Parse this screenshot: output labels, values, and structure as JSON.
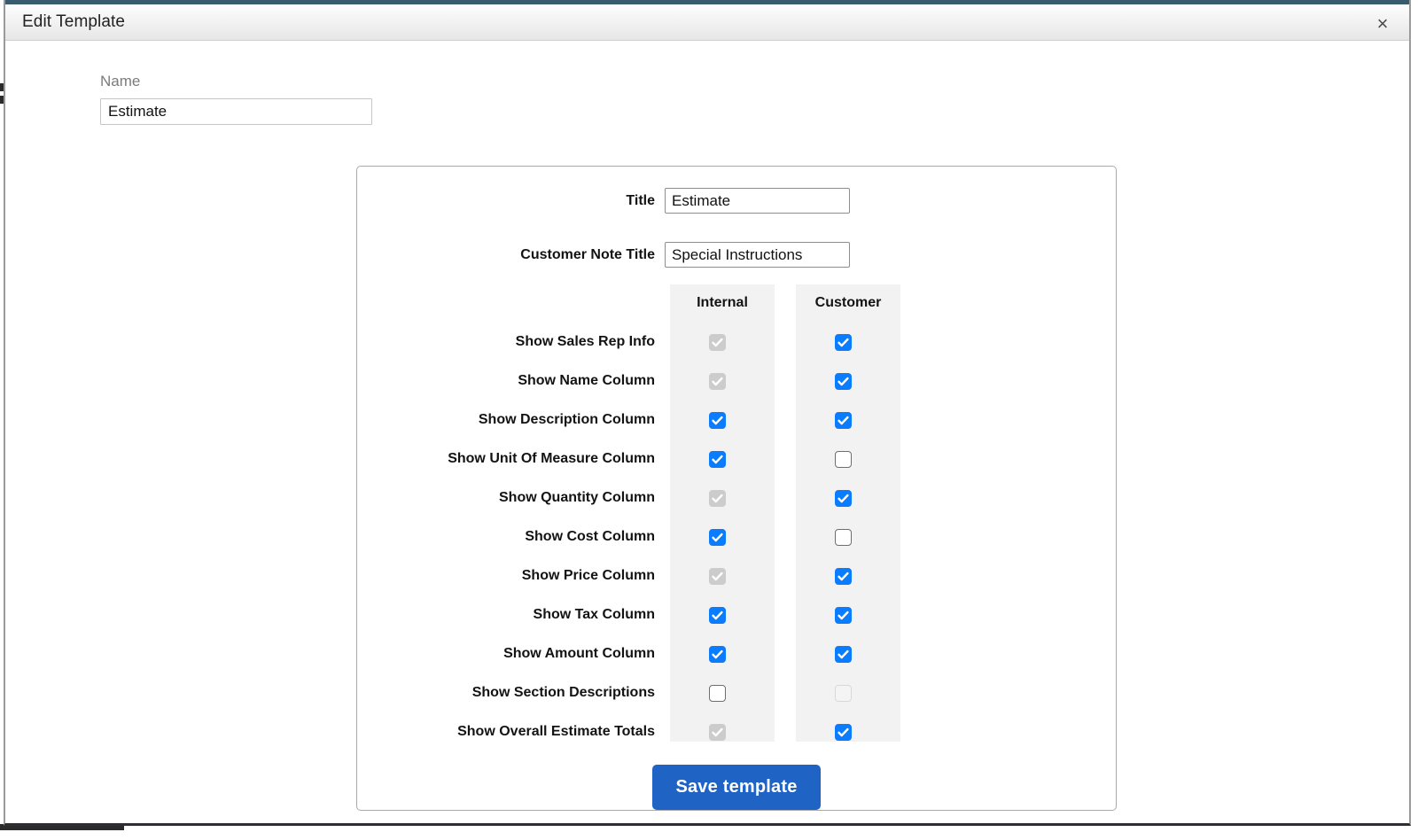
{
  "modal": {
    "title": "Edit Template",
    "close_icon": "close-icon",
    "close_glyph": "×"
  },
  "name_field": {
    "label": "Name",
    "value": "Estimate",
    "placeholder": ""
  },
  "form": {
    "title_field": {
      "label": "Title",
      "value": "Estimate",
      "placeholder": ""
    },
    "note_field": {
      "label": "Customer Note Title",
      "value": "Special Instructions",
      "placeholder": ""
    },
    "columns": [
      {
        "key": "internal",
        "label": "Internal"
      },
      {
        "key": "customer",
        "label": "Customer"
      }
    ],
    "rows": [
      {
        "label": "Show Sales Rep Info",
        "internal": "checked-disabled",
        "customer": "checked"
      },
      {
        "label": "Show Name Column",
        "internal": "checked-disabled",
        "customer": "checked"
      },
      {
        "label": "Show Description Column",
        "internal": "checked",
        "customer": "checked"
      },
      {
        "label": "Show Unit Of Measure Column",
        "internal": "checked",
        "customer": "unchecked"
      },
      {
        "label": "Show Quantity Column",
        "internal": "checked-disabled",
        "customer": "checked"
      },
      {
        "label": "Show Cost Column",
        "internal": "checked",
        "customer": "unchecked"
      },
      {
        "label": "Show Price Column",
        "internal": "checked-disabled",
        "customer": "checked"
      },
      {
        "label": "Show Tax Column",
        "internal": "checked",
        "customer": "checked"
      },
      {
        "label": "Show Amount Column",
        "internal": "checked",
        "customer": "checked"
      },
      {
        "label": "Show Section Descriptions",
        "internal": "unchecked",
        "customer": "unchecked-disabled"
      },
      {
        "label": "Show Overall Estimate Totals",
        "internal": "checked-disabled",
        "customer": "checked"
      }
    ],
    "save_label": "Save template"
  },
  "colors": {
    "checkbox_checked": "#0a7cff",
    "checkbox_disabled": "#cccccc",
    "save_button": "#1f64c4",
    "titlebar_top_border": "#3a5a6e",
    "column_strip": "#f2f2f2"
  }
}
